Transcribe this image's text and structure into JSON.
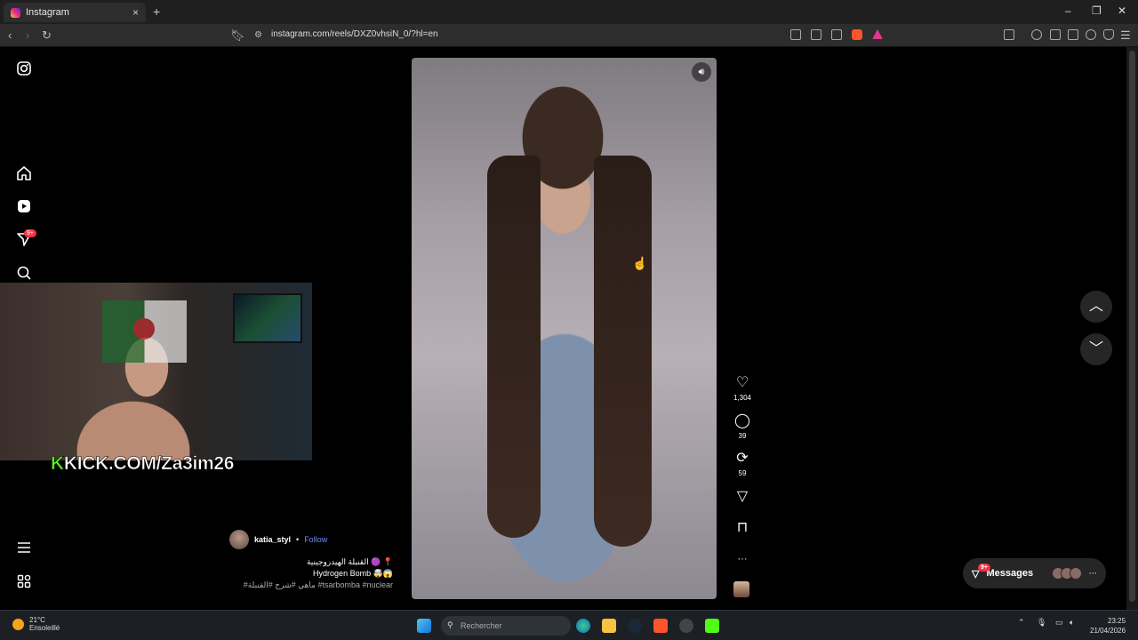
{
  "browser": {
    "tab_title": "Instagram",
    "tab_close": "×",
    "new_tab": "+",
    "url": "instagram.com/reels/DXZ0vhsiN_0/?hl=en",
    "window_controls": [
      "–",
      "❐",
      "✕"
    ]
  },
  "sidebar": {
    "notification_badge": "9+"
  },
  "stream_overlay": {
    "kick_k": "K",
    "kick_text": "KICK.COM/Za3im26"
  },
  "reel": {
    "likes": "1,304",
    "comments": "39",
    "reposts": "59",
    "more": "···",
    "author": "katia_styl",
    "separator": "•",
    "follow": "Follow",
    "caption_line1": "القنبلة الهيدروجينية 🟣 📍",
    "caption_line2": "Hydrogen Bomb 🤯😱",
    "caption_line3": "#ماهي #شرح #القنبلة #tsarbomba #nuclear"
  },
  "messages": {
    "label": "Messages",
    "badge": "9+",
    "more": "···"
  },
  "taskbar": {
    "temperature": "21°C",
    "weather": "Ensoleillé",
    "search_placeholder": "Rechercher",
    "time": "23:25",
    "date": "21/04/2026"
  },
  "colors": {
    "accent_follow": "#6e8cff",
    "badge": "#ff3040",
    "kick_green": "#53fc18"
  }
}
